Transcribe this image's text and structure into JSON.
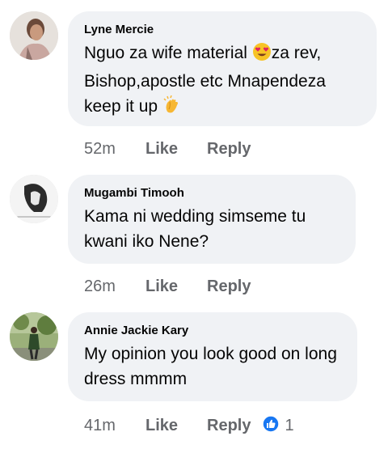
{
  "comments": [
    {
      "author": "Lyne Mercie",
      "text_parts": [
        "Nguo za wife material ",
        "za rev, Bishop,apostle etc Mnapendeza keep it up "
      ],
      "emojis": [
        "heart-eyes-emoji",
        "clapping-hands-emoji"
      ],
      "time": "52m",
      "like_label": "Like",
      "reply_label": "Reply"
    },
    {
      "author": "Mugambi Timooh",
      "text": "Kama ni wedding simseme tu kwani iko Nene?",
      "time": "26m",
      "like_label": "Like",
      "reply_label": "Reply"
    },
    {
      "author": "Annie Jackie Kary",
      "text": "My opinion  you  look good on long dress mmmm",
      "time": "41m",
      "like_label": "Like",
      "reply_label": "Reply",
      "reaction_icon": "like-reaction-icon",
      "reaction_count": "1"
    }
  ],
  "colors": {
    "bubble": "#f0f2f5",
    "meta_text": "#65676b",
    "like_blue": "#1877f2"
  }
}
